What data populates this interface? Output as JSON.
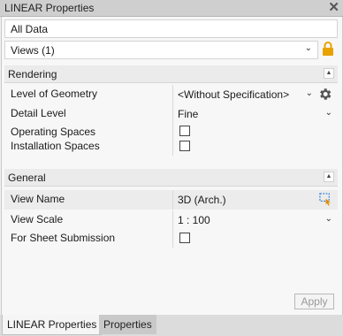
{
  "window": {
    "title": "LINEAR Properties"
  },
  "filters": {
    "scope_value": "All Data",
    "views_value": "Views (1)"
  },
  "rendering": {
    "header": "Rendering",
    "rows": [
      {
        "name": "Level of Geometry",
        "value": "<Without Specification>"
      },
      {
        "name": "Detail Level",
        "value": "Fine"
      },
      {
        "name": "Operating Spaces",
        "checked": false
      },
      {
        "name": "Installation Spaces",
        "checked": false
      }
    ]
  },
  "general": {
    "header": "General",
    "rows": [
      {
        "name": "View Name",
        "value": "3D (Arch.)"
      },
      {
        "name": "View Scale",
        "value": "1 : 100"
      },
      {
        "name": "For Sheet Submission",
        "checked": false
      }
    ]
  },
  "actions": {
    "apply_label": "Apply"
  },
  "tabs": [
    {
      "label": "LINEAR Properties",
      "active": true
    },
    {
      "label": "Properties",
      "active": false
    }
  ],
  "colors": {
    "lock": "#e8a300",
    "accent": "#2a7bd6"
  },
  "icons": [
    "close-icon",
    "chevron-down-icon",
    "lock-icon",
    "collapse-icon",
    "gear-icon",
    "element-picker-icon"
  ]
}
